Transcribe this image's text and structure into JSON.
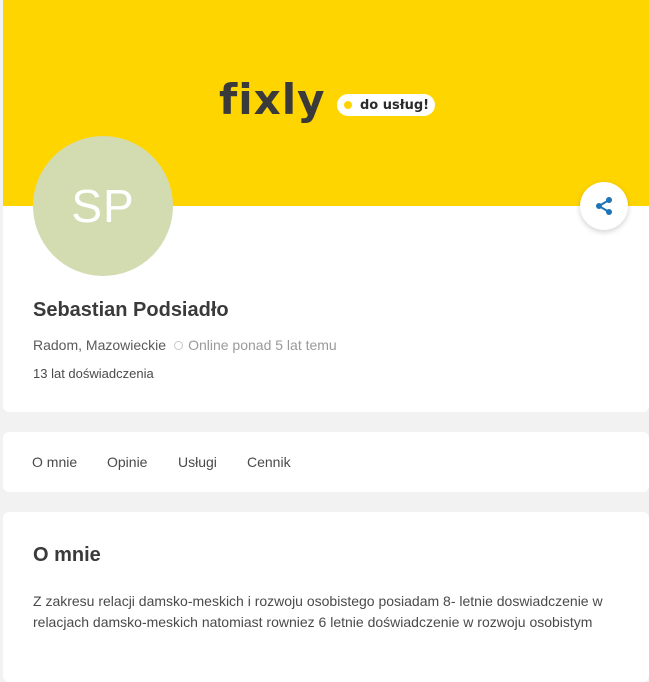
{
  "brand": {
    "logo_text": "fixly",
    "tagline": "do usług!",
    "banner_color": "#ffd500"
  },
  "profile": {
    "avatar_initials": "SP",
    "avatar_color": "#d3dbb0",
    "name": "Sebastian Podsiadło",
    "location": "Radom, Mazowieckie",
    "online_status": "Online ponad 5 lat temu",
    "experience": "13 lat doświadczenia",
    "share_icon": "share-icon",
    "accent_color": "#1f74b7"
  },
  "tabs": [
    {
      "label": "O mnie"
    },
    {
      "label": "Opinie"
    },
    {
      "label": "Usługi"
    },
    {
      "label": "Cennik"
    }
  ],
  "about": {
    "title": "O mnie",
    "text": "Z zakresu relacji damsko-meskich i rozwoju osobistego posiadam 8- letnie doswiadczenie w relacjach damsko-meskich natomiast rowniez 6 letnie doświadczenie w rozwoju osobistym"
  }
}
